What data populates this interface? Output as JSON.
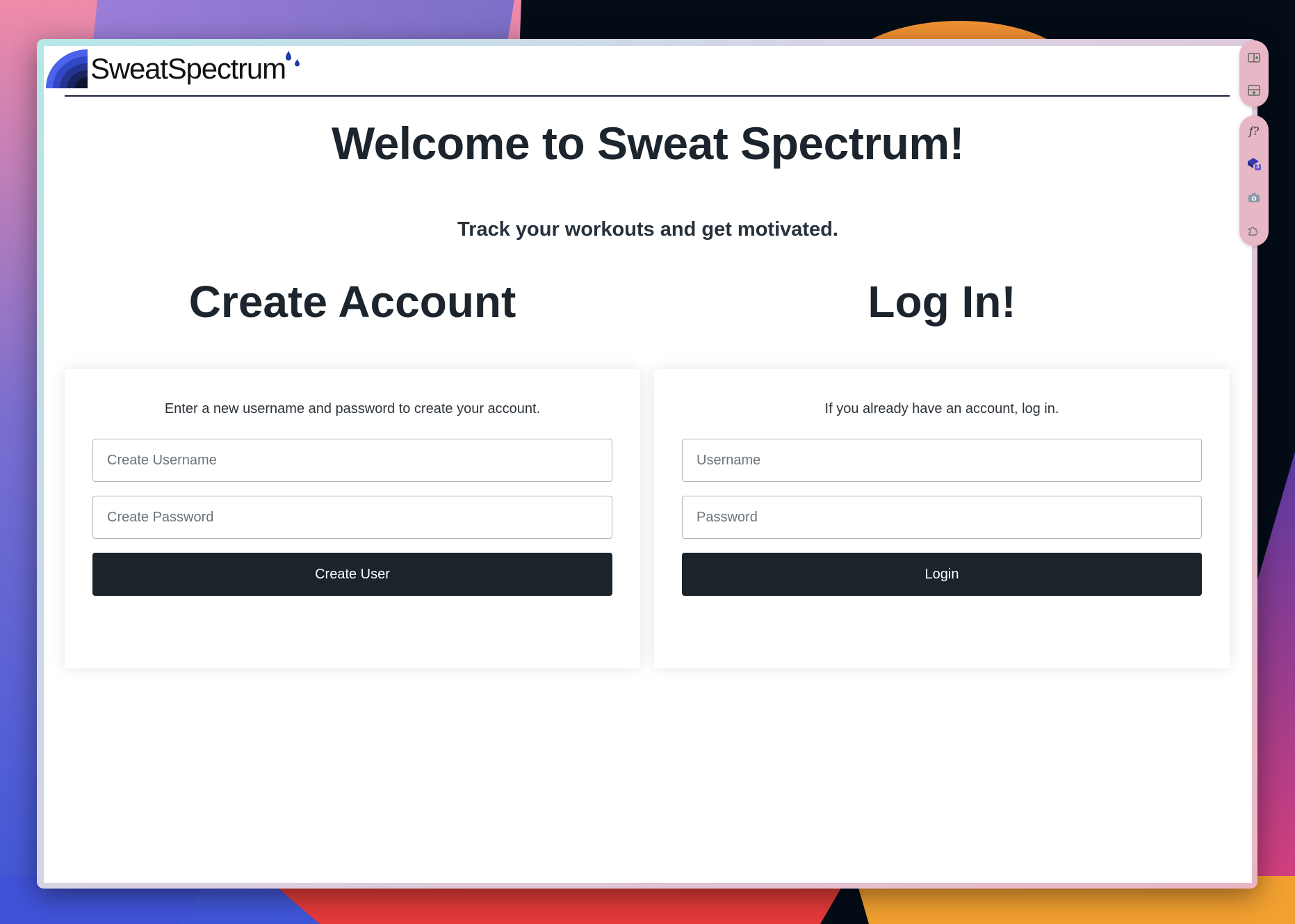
{
  "app": {
    "logo_text": "SweatSpectrum"
  },
  "hero": {
    "title": "Welcome to Sweat Spectrum!",
    "tagline": "Track your workouts and get motivated."
  },
  "create_account": {
    "heading": "Create Account",
    "description": "Enter a new username and password to create your account.",
    "username_placeholder": "Create Username",
    "username_value": "",
    "password_placeholder": "Create Password",
    "password_value": "",
    "button_label": "Create User"
  },
  "login": {
    "heading": "Log In!",
    "description": "If you already have an account, log in.",
    "username_placeholder": "Username",
    "username_value": "",
    "password_placeholder": "Password",
    "password_value": "",
    "button_label": "Login"
  },
  "toolbar": {
    "formula_label": "f?",
    "extension_badge": "3",
    "icons": [
      "split-view-add-icon",
      "panel-add-icon",
      "formula-icon",
      "extension-cube-icon",
      "camera-icon",
      "puzzle-icon"
    ]
  },
  "colors": {
    "primary_button": "#1b242b",
    "heading_text": "#1c252d",
    "header_rule": "#16233a",
    "logo_blue": "#3b52d6"
  }
}
